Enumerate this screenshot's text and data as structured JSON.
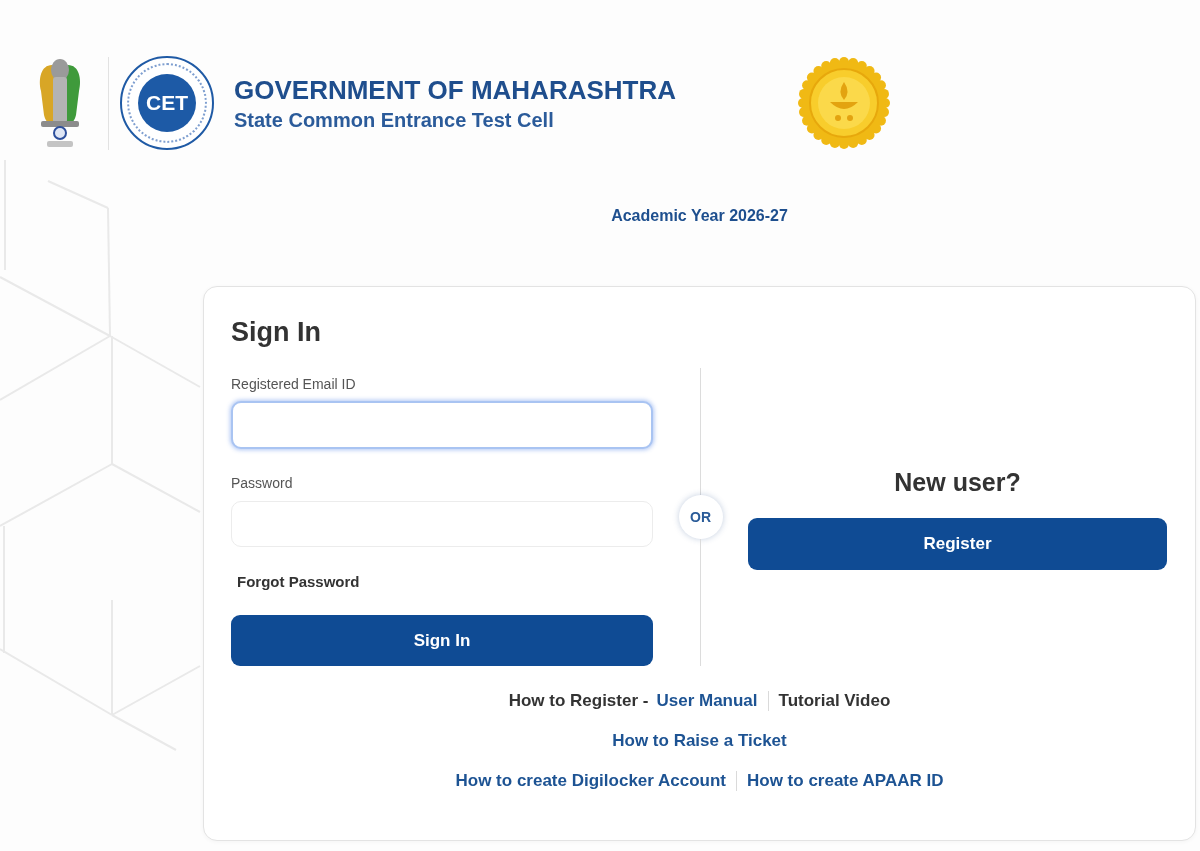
{
  "header": {
    "logo_text": "CET",
    "title": "GOVERNMENT OF MAHARASHTRA",
    "subtitle": "State Common Entrance Test Cell"
  },
  "academic_year": "Academic Year 2026-27",
  "sign_in": {
    "title": "Sign In",
    "fields": [
      {
        "label": "Registered Email ID",
        "focused": true
      },
      {
        "label": "Password",
        "focused": false
      }
    ],
    "forgot_link": "Forgot Password",
    "button": "Sign In"
  },
  "divider_label": "OR",
  "register": {
    "title": "New user?",
    "button": "Register"
  },
  "help_links": [
    {
      "lead": "How to Register -",
      "links": [
        {
          "text": "User Manual",
          "kind": "accent"
        },
        {
          "text": "Tutorial Video",
          "kind": "plain"
        }
      ]
    },
    {
      "links": [
        {
          "text": "How to Raise a Ticket",
          "kind": "accent"
        }
      ]
    },
    {
      "links": [
        {
          "text": "How to create Digilocker Account",
          "kind": "accent"
        },
        {
          "text": "How to create APAAR ID",
          "kind": "accent"
        }
      ]
    }
  ]
}
